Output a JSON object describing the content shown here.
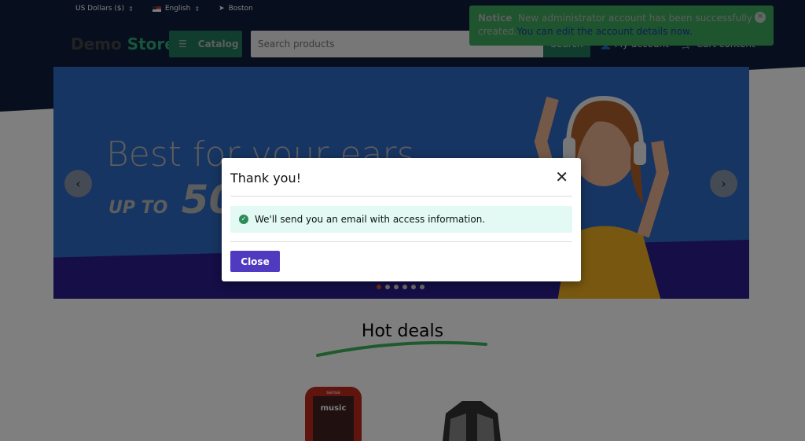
{
  "topbar": {
    "currency": "US Dollars ($)",
    "language": "English",
    "location": "Boston"
  },
  "header": {
    "logo_demo": "Demo",
    "logo_store": "Store",
    "catalog": "Catalog",
    "search_placeholder": "Search products",
    "search_button": "Search",
    "account": "My account",
    "cart": "Cart content"
  },
  "banner": {
    "headline": "Best for your ears",
    "promo_prefix": "UP TO",
    "promo_value": "50",
    "slides": 6,
    "active_slide": 1
  },
  "section": {
    "title": "Hot deals"
  },
  "products": [
    {
      "label": "sansa",
      "screen": "music"
    },
    {
      "label": ""
    }
  ],
  "toast": {
    "title": "Notice",
    "message": "New administrator account has been successfully created.",
    "link": "You can edit the account details now."
  },
  "modal": {
    "title": "Thank you!",
    "message": "We'll send you an email with access information.",
    "close_button": "Close"
  },
  "colors": {
    "brand": "#2fa872",
    "primary_button": "#4f3ac0",
    "toast": "#3daa5c"
  }
}
